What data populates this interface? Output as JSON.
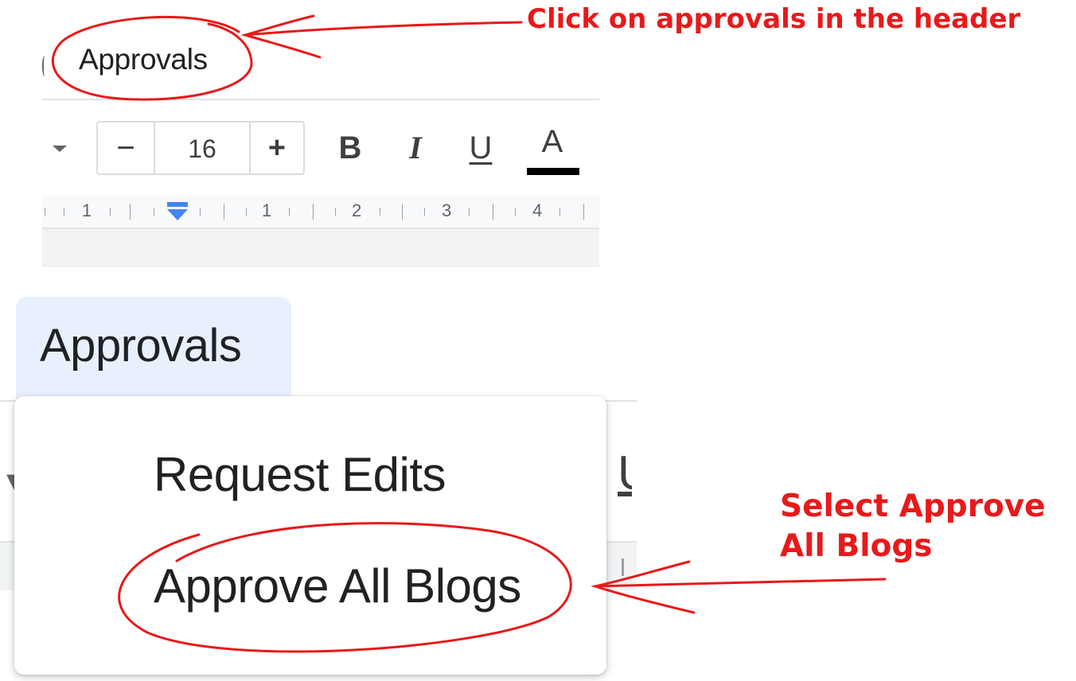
{
  "header": {
    "menu_label": "Approvals"
  },
  "toolbar": {
    "font_size_decrease": "−",
    "font_size_value": "16",
    "font_size_increase": "+",
    "bold_label": "B",
    "italic_label": "I",
    "underline_label": "U",
    "text_color_label": "A",
    "text_color": "#000000"
  },
  "ruler": {
    "labels": [
      "1",
      "1",
      "2",
      "3",
      "4"
    ],
    "marker_color": "#4285f4"
  },
  "approvals_menu": {
    "tab_label": "Approvals",
    "items": [
      {
        "label": "Request Edits"
      },
      {
        "label": "Approve All Blogs"
      }
    ]
  },
  "annotations": {
    "step1": "Click on approvals in the header",
    "step2_line1": "Select Approve",
    "step2_line2": "All Blogs",
    "color": "#e8191a"
  },
  "colors": {
    "tab_highlight": "#e8f0fe",
    "accent_blue": "#4285f4"
  }
}
